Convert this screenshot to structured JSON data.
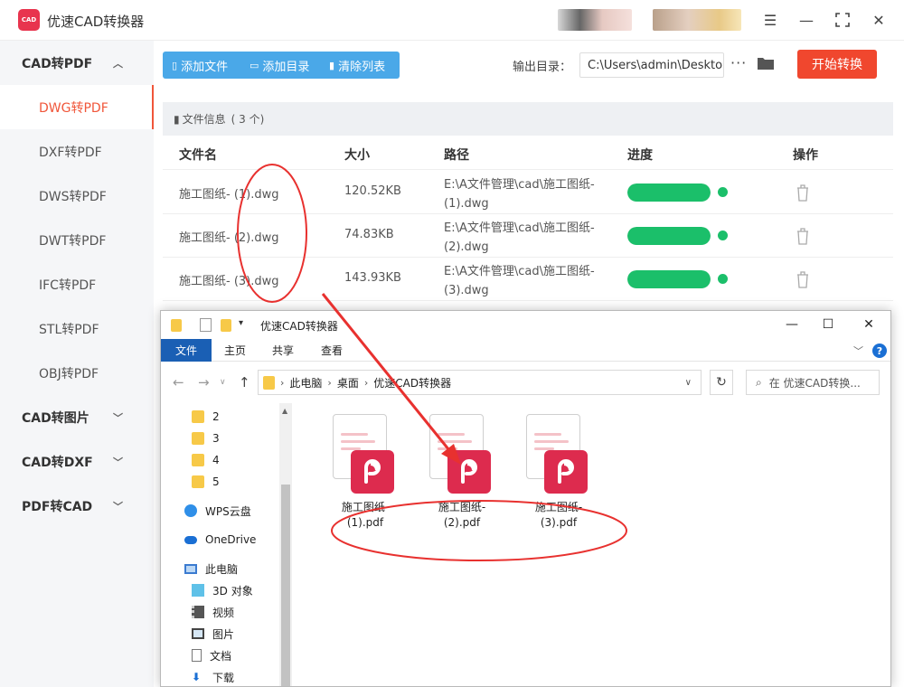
{
  "app": {
    "title": "优速CAD转换器",
    "logo_text": "CAD"
  },
  "window_controls": {
    "menu_icon": "hamburger-icon",
    "minimize_icon": "minimize-icon",
    "maximize_icon": "maximize-icon",
    "close_icon": "close-icon"
  },
  "sidebar": {
    "groups": [
      {
        "label": "CAD转PDF",
        "expanded": true,
        "items": [
          "DWG转PDF",
          "DXF转PDF",
          "DWS转PDF",
          "DWT转PDF",
          "IFC转PDF",
          "STL转PDF",
          "OBJ转PDF"
        ],
        "active_item": "DWG转PDF"
      },
      {
        "label": "CAD转图片",
        "expanded": false
      },
      {
        "label": "CAD转DXF",
        "expanded": false
      },
      {
        "label": "PDF转CAD",
        "expanded": false
      }
    ]
  },
  "toolbar": {
    "add_file": "添加文件",
    "add_folder": "添加目录",
    "clear_list": "清除列表",
    "output_label": "输出目录：",
    "output_path": "C:\\Users\\admin\\Deskto",
    "more": "···",
    "start": "开始转换"
  },
  "file_info": {
    "label": "文件信息",
    "count": "( 3 个)",
    "columns": [
      "文件名",
      "大小",
      "路径",
      "进度",
      "操作"
    ],
    "rows": [
      {
        "name": "施工图纸- (1).dwg",
        "size": "120.52KB",
        "path": "E:\\A文件管理\\cad\\施工图纸- (1).dwg",
        "progress": 1.0
      },
      {
        "name": "施工图纸- (2).dwg",
        "size": "74.83KB",
        "path": "E:\\A文件管理\\cad\\施工图纸- (2).dwg",
        "progress": 1.0
      },
      {
        "name": "施工图纸- (3).dwg",
        "size": "143.93KB",
        "path": "E:\\A文件管理\\cad\\施工图纸- (3).dwg",
        "progress": 1.0
      }
    ]
  },
  "explorer": {
    "title": "优速CAD转换器",
    "ribbon_tabs": [
      "文件",
      "主页",
      "共享",
      "查看"
    ],
    "breadcrumb": [
      "此电脑",
      "桌面",
      "优速CAD转换器"
    ],
    "search_placeholder": "在 优速CAD转换...",
    "nav_items": [
      "2",
      "3",
      "4",
      "5",
      "WPS云盘",
      "OneDrive",
      "此电脑",
      "3D 对象",
      "视频",
      "图片",
      "文档",
      "下载"
    ],
    "files": [
      {
        "name_line1": "施工图纸-",
        "name_line2": "(1).pdf"
      },
      {
        "name_line1": "施工图纸-",
        "name_line2": "(2).pdf"
      },
      {
        "name_line1": "施工图纸-",
        "name_line2": "(3).pdf"
      }
    ]
  },
  "colors": {
    "accent_red": "#f0472e",
    "active_item": "#f0563a",
    "toolbar_blue": "#4aa8e8",
    "progress_green": "#1bbf6a",
    "pdf_red": "#dd2b4e",
    "annotation_red": "#e8312f"
  }
}
